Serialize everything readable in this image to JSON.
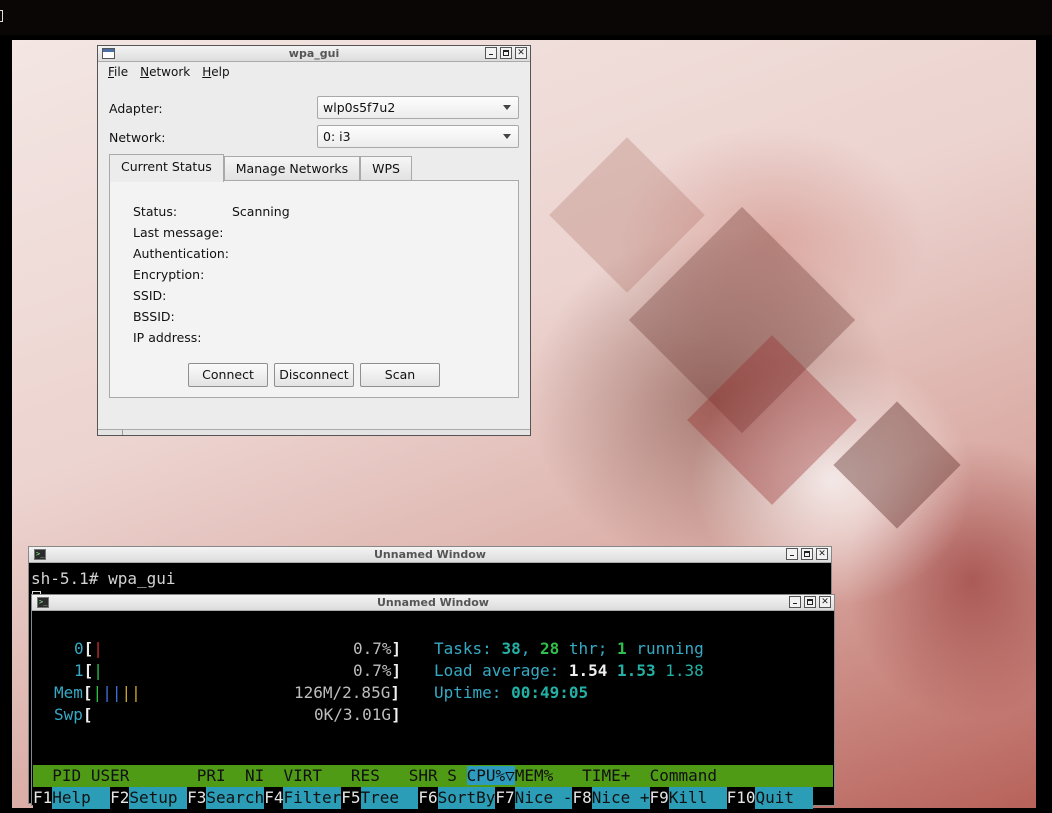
{
  "wpa_gui": {
    "window_title": "wpa_gui",
    "menu": [
      "File",
      "Network",
      "Help"
    ],
    "adapter_label": "Adapter:",
    "adapter_value": "wlp0s5f7u2",
    "network_label": "Network:",
    "network_value": "0: i3",
    "tabs": [
      "Current Status",
      "Manage Networks",
      "WPS"
    ],
    "status": {
      "status_label": "Status:",
      "status_value": "Scanning",
      "last_message_label": "Last message:",
      "authentication_label": "Authentication:",
      "encryption_label": "Encryption:",
      "ssid_label": "SSID:",
      "bssid_label": "BSSID:",
      "ip_address_label": "IP address:"
    },
    "buttons": {
      "connect": "Connect",
      "disconnect": "Disconnect",
      "scan": "Scan"
    }
  },
  "terminal1": {
    "window_title": "Unnamed Window",
    "prompt_line": "sh-5.1# wpa_gui"
  },
  "terminal2": {
    "window_title": "Unnamed Window",
    "cpu0": {
      "label": "0",
      "percent": "0.7%"
    },
    "cpu1": {
      "label": "1",
      "percent": "0.7%"
    },
    "mem": {
      "label": "Mem",
      "value": "126M/2.85G"
    },
    "swp": {
      "label": "Swp",
      "value": "0K/3.01G"
    },
    "tasks": {
      "label": "Tasks:",
      "count": "38",
      "thr": "28",
      "thr_label": "thr;",
      "running": "1",
      "running_label": "running"
    },
    "load": {
      "label": "Load average:",
      "v1": "1.54",
      "v2": "1.53",
      "v3": "1.38"
    },
    "uptime": {
      "label": "Uptime:",
      "value": "00:49:05"
    },
    "columns": [
      "PID",
      "USER",
      "PRI",
      "NI",
      "VIRT",
      "RES",
      "SHR",
      "S",
      "CPU%▽",
      "MEM%",
      "TIME+",
      "Command"
    ],
    "fkeys": [
      {
        "key": "F1",
        "label": "Help  "
      },
      {
        "key": "F2",
        "label": "Setup "
      },
      {
        "key": "F3",
        "label": "Search"
      },
      {
        "key": "F4",
        "label": "Filter"
      },
      {
        "key": "F5",
        "label": "Tree  "
      },
      {
        "key": "F6",
        "label": "SortBy"
      },
      {
        "key": "F7",
        "label": "Nice -"
      },
      {
        "key": "F8",
        "label": "Nice +"
      },
      {
        "key": "F9",
        "label": "Kill  "
      },
      {
        "key": "F10",
        "label": "Quit  "
      }
    ]
  }
}
